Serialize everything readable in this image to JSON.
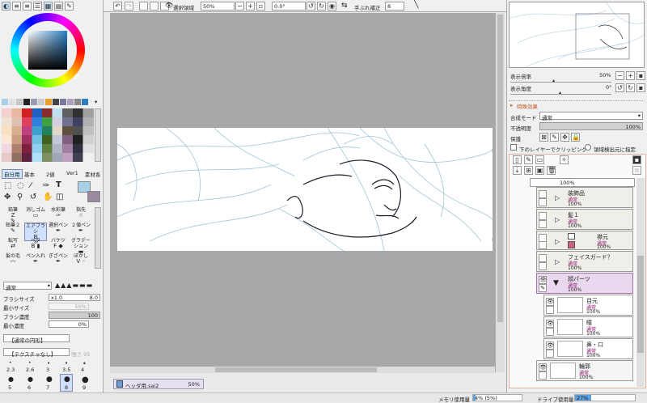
{
  "toolbar": {
    "selection_label": "選択領域",
    "zoom": "50%",
    "angle": "0.0°",
    "stabilizer_label": "手ぶれ補正",
    "stabilizer_value": "8"
  },
  "navigator": {
    "zoom_label": "表示倍率",
    "zoom_value": "50%",
    "angle_label": "表示角度",
    "angle_value": "0°"
  },
  "layer_props": {
    "effects": "特殊効果",
    "blend_label": "合成モード",
    "blend_value": "通常",
    "opacity_label": "不透明度",
    "opacity_value": "100%",
    "protect_label": "保護",
    "clip_label": "下のレイヤーでクリッピング",
    "source_label": "領域検出元に指定"
  },
  "layers": {
    "top_partial_opacity": "100%",
    "items": [
      {
        "name": "装飾品",
        "mode": "通常",
        "opacity": "100%"
      },
      {
        "name": "髪１",
        "mode": "通常",
        "opacity": "100%"
      },
      {
        "name": "襟元",
        "mode": "通常",
        "opacity": "100%"
      },
      {
        "name": "フェイスガード？",
        "mode": "通常",
        "opacity": "100%"
      },
      {
        "name": "顔パーツ",
        "mode": "通常",
        "opacity": "100%"
      },
      {
        "name": "目元",
        "mode": "通常",
        "opacity": "100%"
      },
      {
        "name": "瞳",
        "mode": "通常",
        "opacity": "100%"
      },
      {
        "name": "鼻・口",
        "mode": "通常",
        "opacity": "100%"
      },
      {
        "name": "輪郭",
        "mode": "通常",
        "opacity": "100%"
      }
    ]
  },
  "tool_tabs": [
    "自分用",
    "基本",
    "2値",
    "Ver1",
    "素材系"
  ],
  "tools": [
    [
      "鉛筆",
      "消しゴム",
      "水彩筆",
      "指先"
    ],
    [
      "鉛筆２",
      "エアブラシ",
      "選択ペン",
      "２値ペン"
    ],
    [
      "転写",
      "ペタ",
      "バケツ",
      "グラデーション"
    ],
    [
      "髪の毛",
      "ペン入れ",
      "ぎざペン",
      "ぼかし"
    ]
  ],
  "tool_keys": [
    "Z",
    "B",
    "F",
    "V"
  ],
  "brush": {
    "mode": "通常",
    "size_label": "ブラシサイズ",
    "size_mult": "x1.0",
    "size_value": "8.0",
    "min_size_label": "最小サイズ",
    "min_size_value": "50%",
    "density_label": "ブラシ濃度",
    "density_value": "100",
    "min_density_label": "最小濃度",
    "min_density_value": "0%",
    "shape": "【通常の円形】",
    "texture": "【テクスチャなし】",
    "texture_strength": "強さ 95"
  },
  "brush_sizes_row1": [
    "2.3",
    "2.6",
    "3",
    "3.5",
    "4"
  ],
  "brush_sizes_row2": [
    "5",
    "6",
    "7",
    "8",
    "9"
  ],
  "document": {
    "filename": "ヘッダ用.sai2",
    "zoom": "50%"
  },
  "status": {
    "memory_label": "メモリ使用量",
    "memory_value": "4% (5%)",
    "drive_label": "ドライブ使用量",
    "drive_value": "27%"
  },
  "colors": {
    "canvas_bg": "#a8a8a8",
    "accent": "#5aa0e0",
    "selected_layer": "#ead8ee",
    "line_art": "#9fc4d8"
  }
}
